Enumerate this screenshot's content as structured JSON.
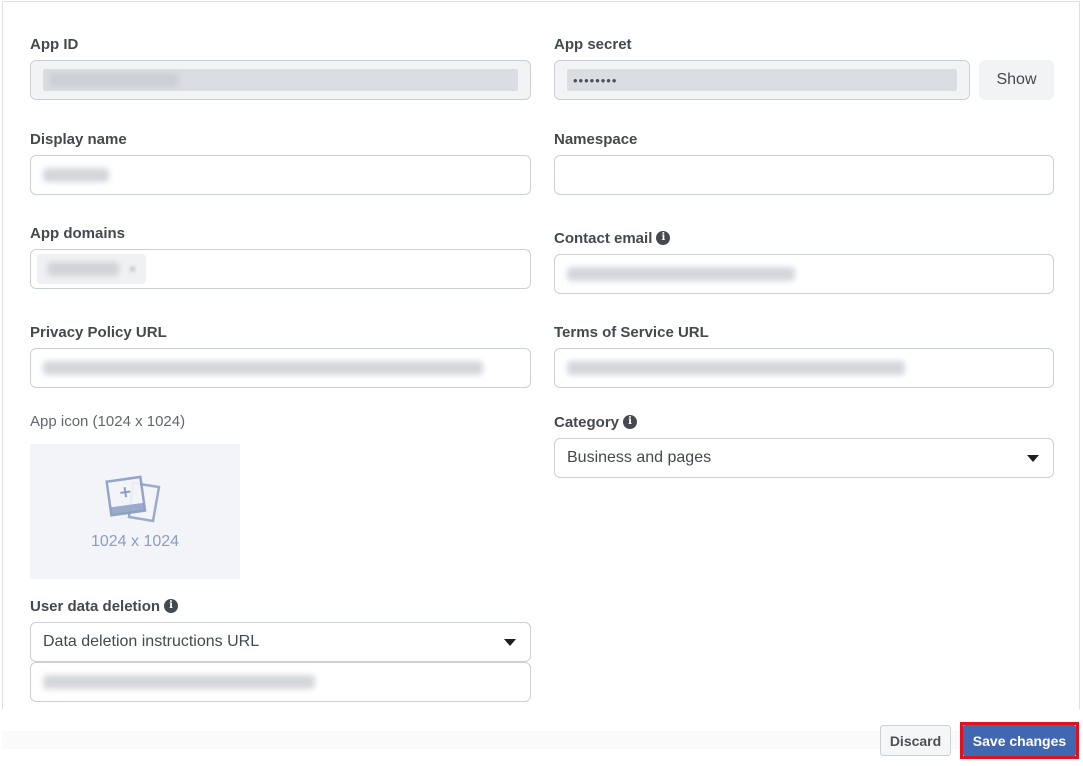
{
  "form": {
    "app_id": {
      "label": "App ID",
      "value_redacted": true
    },
    "app_secret": {
      "label": "App secret",
      "value": "••••••••",
      "show_label": "Show"
    },
    "display_name": {
      "label": "Display name",
      "value_redacted": true
    },
    "namespace": {
      "label": "Namespace",
      "value": ""
    },
    "app_domains": {
      "label": "App domains",
      "chip_redacted": true,
      "chip_remove": "×"
    },
    "contact_email": {
      "label": "Contact email",
      "info_icon": "i",
      "value_redacted": true
    },
    "privacy_policy_url": {
      "label": "Privacy Policy URL",
      "value_redacted": true
    },
    "terms_of_service_url": {
      "label": "Terms of Service URL",
      "value_redacted": true
    },
    "app_icon": {
      "label": "App icon (1024 x 1024)",
      "placeholder_text": "1024 x 1024"
    },
    "category": {
      "label": "Category",
      "info_icon": "i",
      "selected": "Business and pages"
    },
    "user_data_deletion": {
      "label": "User data deletion",
      "info_icon": "i",
      "selected": "Data deletion instructions URL",
      "url_redacted": true
    }
  },
  "footer": {
    "discard_label": "Discard",
    "save_label": "Save changes"
  },
  "colors": {
    "primary": "#4267b2",
    "highlight_outline": "#e3101e",
    "icon_placeholder": "#8b9dc3"
  }
}
